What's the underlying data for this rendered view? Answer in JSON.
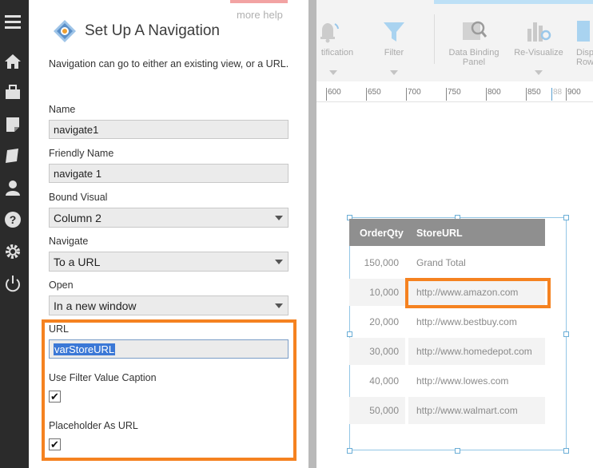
{
  "panel": {
    "more_help": "more help",
    "title": "Set Up A Navigation",
    "description": "Navigation can go to either an existing view, or a URL.",
    "name_label": "Name",
    "name_value": "navigate1",
    "friendly_label": "Friendly Name",
    "friendly_value": "navigate 1",
    "bound_label": "Bound Visual",
    "bound_value": "Column 2",
    "navigate_label": "Navigate",
    "navigate_value": "To a URL",
    "open_label": "Open",
    "open_value": "In a new window",
    "url_label": "URL",
    "url_value": "varStoreURL",
    "use_filter_label": "Use Filter Value Caption",
    "use_filter_checked": "✔",
    "placeholder_label": "Placeholder As URL",
    "placeholder_checked": "✔"
  },
  "rail": {
    "icons": [
      "menu-icon",
      "home-icon",
      "briefcase-icon",
      "note-icon",
      "pages-icon",
      "user-icon",
      "help-icon",
      "gear-icon",
      "power-icon"
    ]
  },
  "toolbar": {
    "notification_label": "tification",
    "filter_label": "Filter",
    "data_binding_label_1": "Data Binding",
    "data_binding_label_2": "Panel",
    "revisualize_label": "Re-Visualize",
    "display_label_1": "Displ",
    "display_label_2": "Row"
  },
  "ruler": {
    "ticks": [
      "600",
      "650",
      "700",
      "750",
      "800",
      "850",
      "88",
      "900"
    ]
  },
  "table": {
    "headers": [
      "OrderQty",
      "StoreURL"
    ],
    "rows": [
      {
        "qty": "150,000",
        "url": "Grand Total"
      },
      {
        "qty": "10,000",
        "url": "http://www.amazon.com"
      },
      {
        "qty": "20,000",
        "url": "http://www.bestbuy.com"
      },
      {
        "qty": "30,000",
        "url": "http://www.homedepot.com"
      },
      {
        "qty": "40,000",
        "url": "http://www.lowes.com"
      },
      {
        "qty": "50,000",
        "url": "http://www.walmart.com"
      }
    ]
  },
  "colors": {
    "accent_orange": "#f58220",
    "rail": "#2b2b2b",
    "header_gray": "#8f8f8f"
  }
}
